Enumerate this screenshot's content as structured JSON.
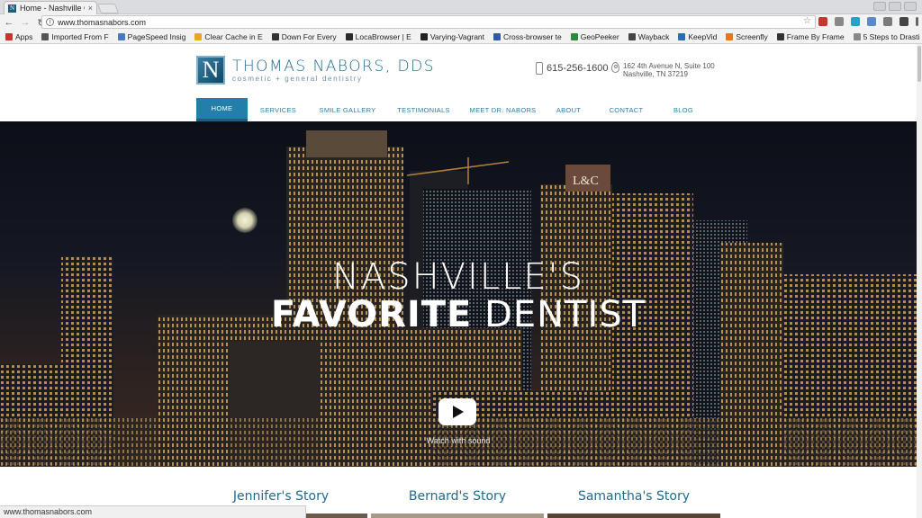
{
  "browser": {
    "tab_title": "Home - Nashville C",
    "tab_close": "×",
    "url": "www.thomasnabors.com",
    "status_url": "www.thomasnabors.com",
    "bookmarks": [
      {
        "label": "Apps",
        "color": "#c7352c"
      },
      {
        "label": "Imported From F",
        "color": "#555555"
      },
      {
        "label": "PageSpeed Insig",
        "color": "#4a79c4"
      },
      {
        "label": "Clear Cache in E",
        "color": "#e5a823"
      },
      {
        "label": "Down For Every",
        "color": "#333333"
      },
      {
        "label": "LocaBrowser | E",
        "color": "#2b2b2b"
      },
      {
        "label": "Varying-Vagrant",
        "color": "#222222"
      },
      {
        "label": "Cross-browser te",
        "color": "#2e5aa8"
      },
      {
        "label": "GeoPeeker",
        "color": "#2c8a3a"
      },
      {
        "label": "Wayback",
        "color": "#444444"
      },
      {
        "label": "KeepVid",
        "color": "#2a6fb3"
      },
      {
        "label": "Screenfly",
        "color": "#e07a20"
      },
      {
        "label": "Frame By Frame",
        "color": "#333333"
      },
      {
        "label": "5 Steps to Drasti",
        "color": "#888888"
      }
    ]
  },
  "site": {
    "logo_letter": "N",
    "name": "THOMAS NABORS, DDS",
    "tagline": "cosmetic + general dentistry",
    "phone": "615-256-1600",
    "address_line1": "162 4th Avenue N, Suite 100",
    "address_line2": "Nashville, TN 37219",
    "nav": [
      {
        "label": "HOME",
        "active": true
      },
      {
        "label": "SERVICES",
        "active": false
      },
      {
        "label": "SMILE GALLERY",
        "active": false
      },
      {
        "label": "TESTIMONIALS",
        "active": false
      },
      {
        "label": "MEET DR. NABORS",
        "active": false
      },
      {
        "label": "ABOUT",
        "active": false
      },
      {
        "label": "CONTACT",
        "active": false
      },
      {
        "label": "BLOG",
        "active": false
      }
    ]
  },
  "hero": {
    "line1": "NASHVILLE'S",
    "line2_bold": "FAVORITE",
    "line2_rest": " DENTIST",
    "watch_label": "Watch with sound",
    "building_sign": "L&C"
  },
  "stories": [
    {
      "title": "Jennifer's Story"
    },
    {
      "title": "Bernard's Story"
    },
    {
      "title": "Samantha's Story"
    }
  ]
}
